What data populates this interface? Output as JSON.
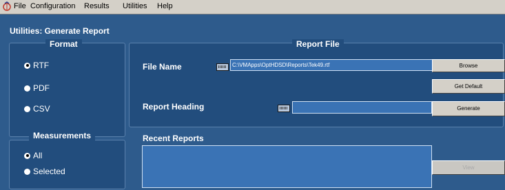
{
  "menubar": {
    "items": [
      "File",
      "Configuration",
      "Results",
      "Utilities",
      "Help"
    ]
  },
  "page": {
    "title": "Utilities: Generate Report"
  },
  "format": {
    "title": "Format",
    "options": [
      "RTF",
      "PDF",
      "CSV"
    ],
    "selected": "RTF"
  },
  "measurements": {
    "title": "Measurements",
    "options": [
      "All",
      "Selected"
    ],
    "selected": "All"
  },
  "report_file": {
    "title": "Report File",
    "file_name_label": "File Name",
    "file_name_value": "C:\\VMApps\\OptHDSD\\Reports\\Tek49.rtf",
    "browse_label": "Browse",
    "get_default_label": "Get Default",
    "heading_label": "Report Heading",
    "heading_value": "",
    "generate_label": "Generate",
    "recent_label": "Recent Reports",
    "view_label": "View"
  },
  "colors": {
    "background": "#2e5b8c",
    "panel": "#224d7d",
    "field": "#3a73b5",
    "menubar": "#d4d0c8"
  }
}
